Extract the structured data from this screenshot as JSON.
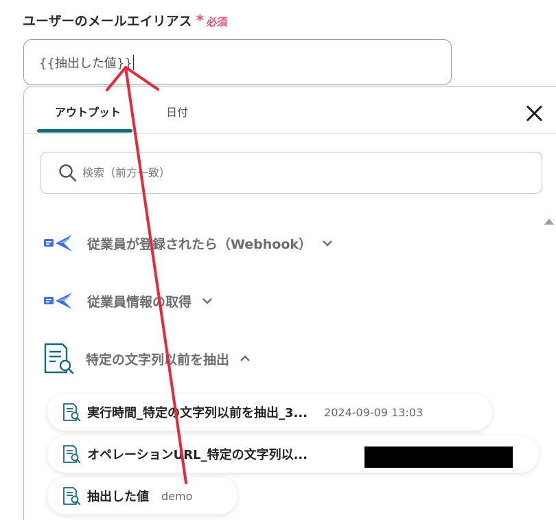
{
  "field": {
    "label": "ユーザーのメールエイリアス",
    "required_mark": "*",
    "required_text": "必須",
    "value": "{{抽出した値}}"
  },
  "panel": {
    "tabs": [
      {
        "label": "アウトプット",
        "active": true
      },
      {
        "label": "日付",
        "active": false
      }
    ],
    "search_placeholder": "検索（前方一致）",
    "sections": [
      {
        "title": "従業員が登録されたら（Webhook）",
        "icon": "app-logo-icon",
        "expanded": false
      },
      {
        "title": "従業員情報の取得",
        "icon": "app-logo-icon",
        "expanded": false
      },
      {
        "title": "特定の文字列以前を抽出",
        "icon": "document-search-icon",
        "expanded": true
      }
    ],
    "items": [
      {
        "label": "実行時間_特定の文字列以前を抽出_3...",
        "value": "2024-09-09 13:03"
      },
      {
        "label": "オペレーションURL_特定の文字列以...",
        "value": ""
      },
      {
        "label": "抽出した値",
        "value": "demo"
      }
    ]
  },
  "colors": {
    "accent": "#16697a",
    "required": "#e8506b",
    "annotation": "#e8283a",
    "app_logo": "#3d6fe0"
  }
}
